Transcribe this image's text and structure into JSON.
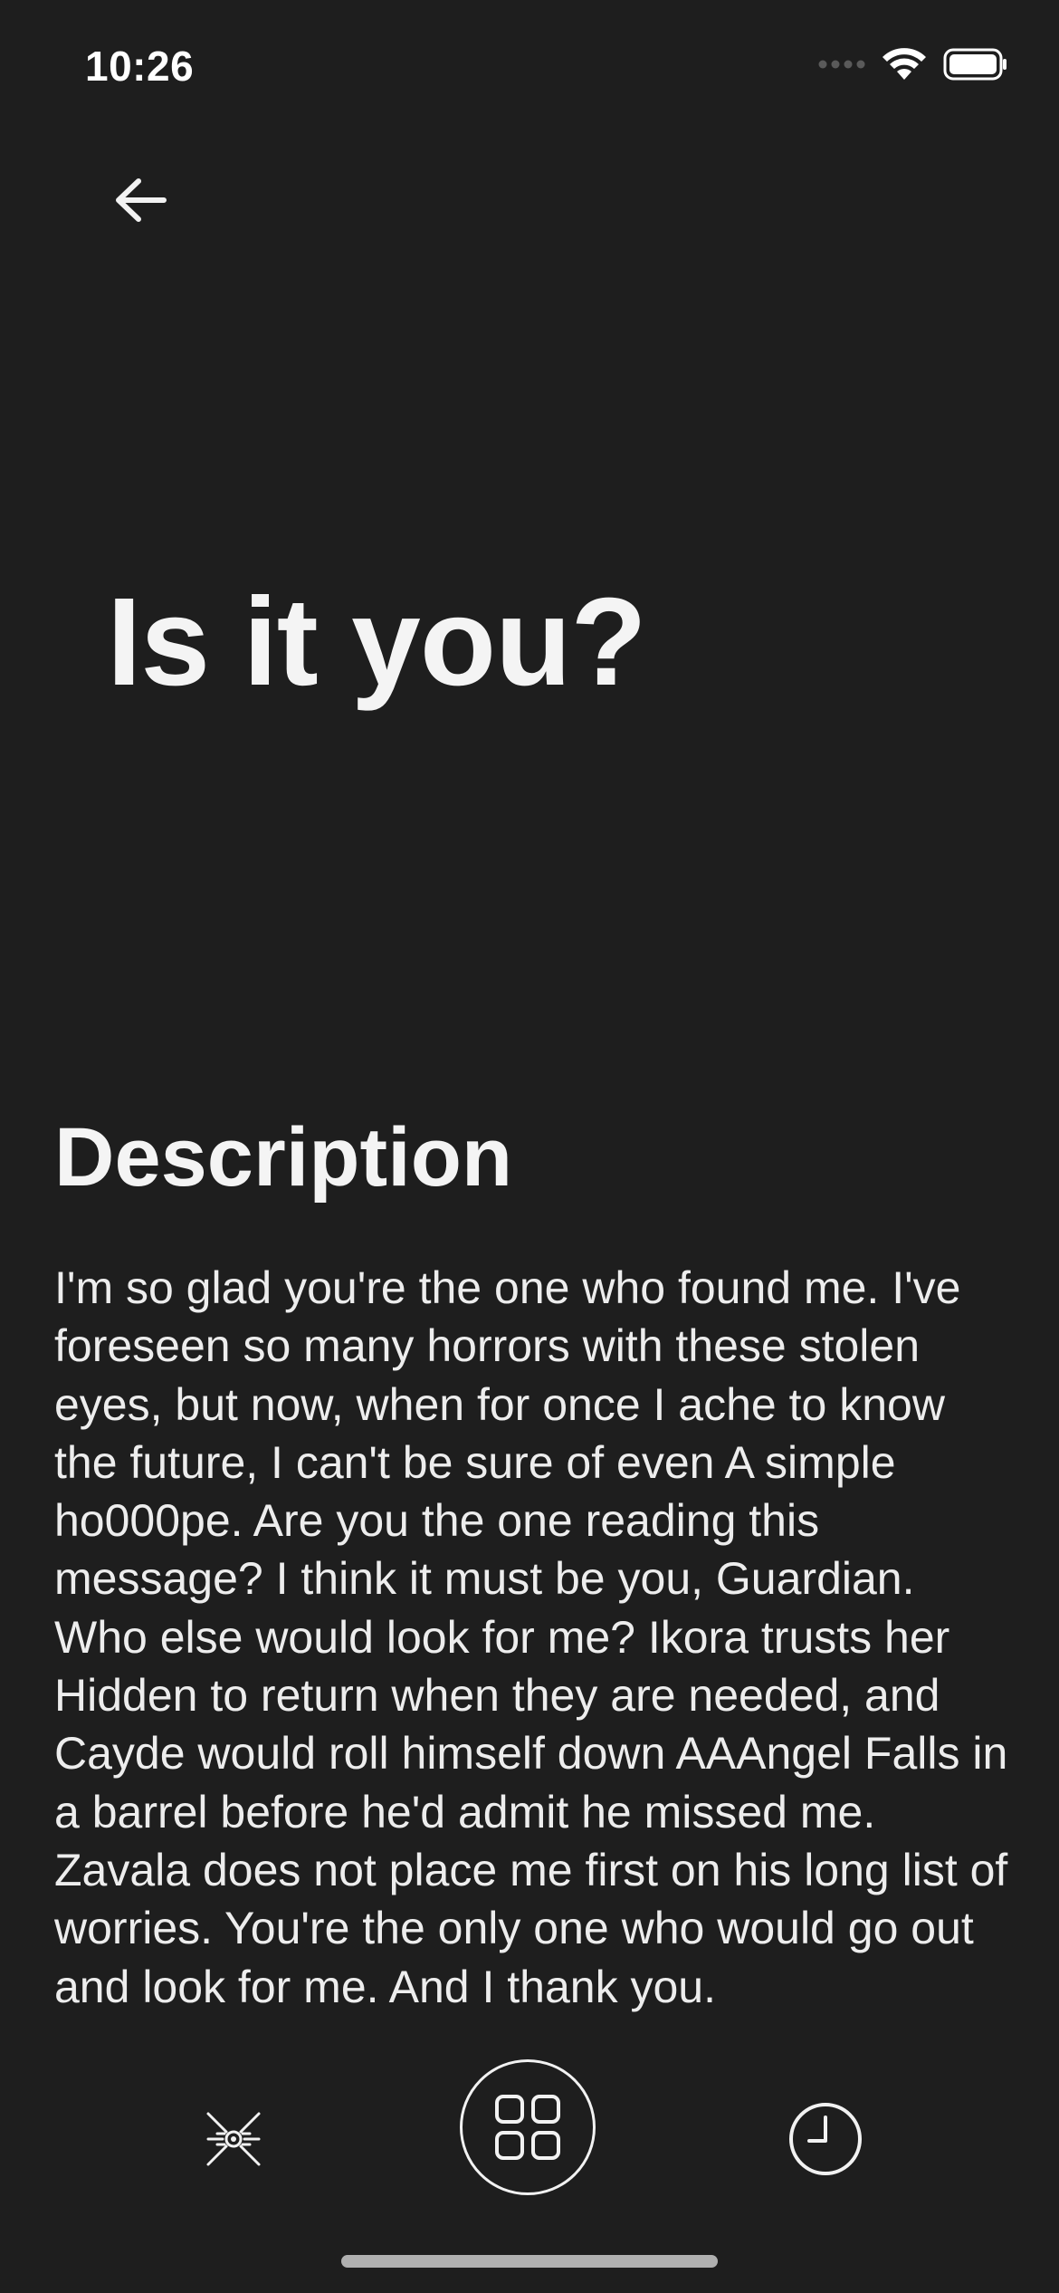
{
  "status_bar": {
    "time": "10:26"
  },
  "header": {
    "back_icon": "arrow-left-icon"
  },
  "title": "Is it you?",
  "description": {
    "heading": "Description",
    "body": "I'm so glad you're the one who found me. I've foreseen so many horrors with these stolen eyes, but now, when for once I ache to know the future, I can't be sure of even A simple ho000pe. Are you the one reading this message? I think it must be you, Guardian. Who else would look for me? Ikora trusts her Hidden to return when they are needed, and Cayde would roll himself down AAAngel Falls in a barrel before he'd admit he missed me. Zavala does not place me first on his long list of worries. You're the only one who would go out and look for me. And I thank you."
  },
  "tab_bar": {
    "items": [
      {
        "icon": "ghost-sun-icon"
      },
      {
        "icon": "grid-icon"
      },
      {
        "icon": "clock-icon"
      }
    ]
  },
  "colors": {
    "background": "#1e1e1e",
    "text": "#f2f2f2",
    "home_indicator": "#b0b0b0"
  }
}
